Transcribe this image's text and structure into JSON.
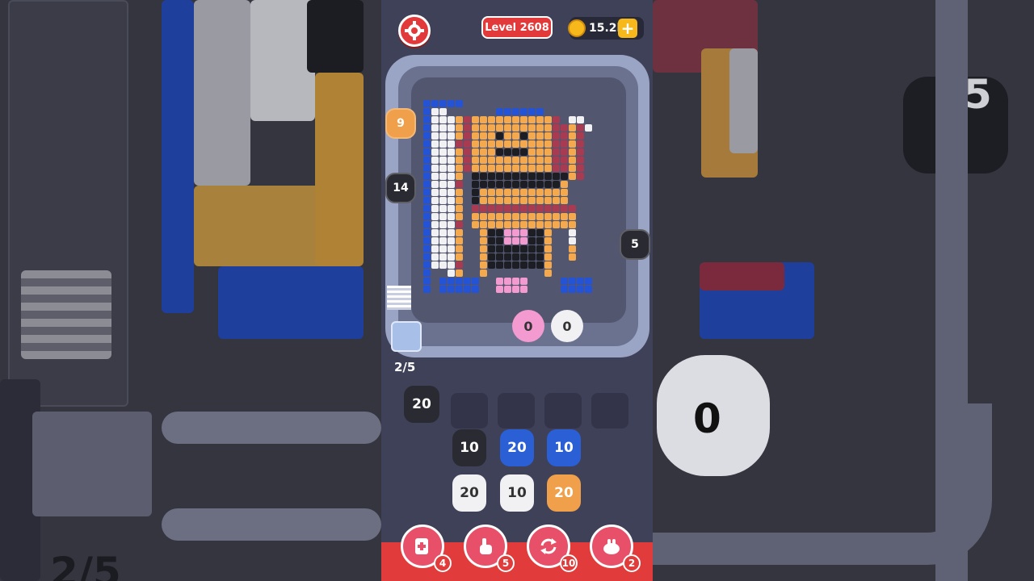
{
  "hud": {
    "level_label": "Level 2608",
    "coins_label": "15.2k",
    "plus_label": "+"
  },
  "waiting_shooters": [
    {
      "count": "9",
      "color": "#f0a04a"
    },
    {
      "count": "14",
      "color": "#2a2b32"
    },
    {
      "count": "5",
      "color": "#2a2b32"
    }
  ],
  "belt_shooters": [
    {
      "count": "0",
      "color": "#f39ad0"
    },
    {
      "count": "0",
      "color": "#f1f1f4"
    }
  ],
  "progress": "2/5",
  "queue_slot": {
    "count": "20",
    "color": "#2a2b32"
  },
  "shooters": [
    {
      "count": "10",
      "color": "#2a2b32"
    },
    {
      "count": "20",
      "color": "#2a5fd6"
    },
    {
      "count": "10",
      "color": "#2a5fd6"
    },
    {
      "count": "20",
      "color": "#f1f1f4"
    },
    {
      "count": "10",
      "color": "#f1f1f4"
    },
    {
      "count": "20",
      "color": "#f0a04a"
    }
  ],
  "boosters": [
    {
      "name": "add-slot",
      "count": "4"
    },
    {
      "name": "hand",
      "count": "5"
    },
    {
      "name": "shuffle",
      "count": "10"
    },
    {
      "name": "magnet",
      "count": "2"
    }
  ],
  "background": {
    "right_big_number": "5",
    "right_belt_number": "0",
    "left_progress": "2/5"
  },
  "colors": {
    "black": "#1d1e24",
    "white": "#f1f1f4",
    "orange": "#f4a94e",
    "maroon": "#a83a52",
    "blue": "#2453d6",
    "pink": "#f39ad0"
  }
}
